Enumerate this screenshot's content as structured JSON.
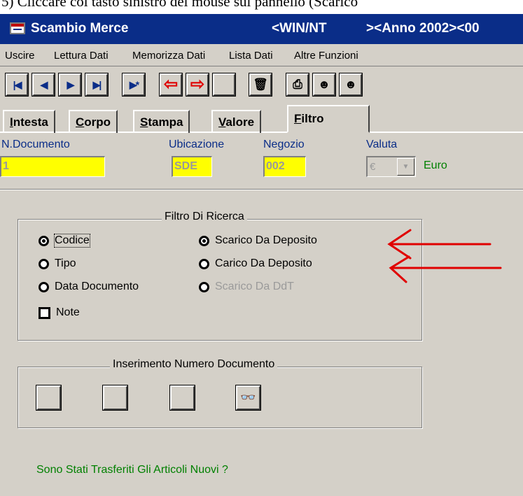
{
  "caption": "5)  Cliccare  col tasto sinistro del mouse sul pannello (Scarico",
  "window": {
    "title": "Scambio Merce",
    "system_a": "<WIN/NT",
    "system_b": "><Anno 2002><00"
  },
  "menu": [
    "Uscire",
    "Lettura Dati",
    "Memorizza Dati",
    "Lista Dati",
    "Altre Funzioni"
  ],
  "toolbar": {
    "icons": [
      "first-record",
      "previous-record",
      "next-record",
      "last-record",
      "new-record",
      "arrow-left",
      "arrow-right",
      "blank",
      "trash",
      "printer",
      "person",
      "person"
    ]
  },
  "tabs": [
    {
      "first": "I",
      "rest": "ntesta"
    },
    {
      "first": "C",
      "rest": "orpo"
    },
    {
      "first": "S",
      "rest": "tampa"
    },
    {
      "first": "V",
      "rest": "alore"
    },
    {
      "first": "F",
      "rest": "iltro"
    }
  ],
  "fields": {
    "documento": {
      "label": "N.Documento",
      "value": "1"
    },
    "ubicazione": {
      "label": "Ubicazione",
      "value": "SDE"
    },
    "negozio": {
      "label": "Negozio",
      "value": "002"
    },
    "valuta": {
      "label": "Valuta",
      "value": "€",
      "name": "Euro"
    }
  },
  "filtro": {
    "legend": "Filtro Di Ricerca",
    "left": [
      {
        "label": "Codice",
        "checked": true
      },
      {
        "label": "Tipo",
        "checked": false
      },
      {
        "label": "Data Documento",
        "checked": false
      }
    ],
    "right": [
      {
        "label": "Scarico Da Deposito",
        "checked": true
      },
      {
        "label": "Carico Da Deposito",
        "checked": false
      },
      {
        "label": "Scarico Da DdT",
        "checked": false,
        "disabled": true
      }
    ],
    "note_label": "Note"
  },
  "inserimento": {
    "legend": "Inserimento Numero Documento",
    "buttons": [
      "blank",
      "blank",
      "blank",
      "binoculars"
    ]
  },
  "status_message": "Sono Stati Trasferiti  Gli Articoli Nuovi ?",
  "colors": {
    "titlebar": "#0a2d88",
    "face": "#d4d0c8",
    "field_yellow": "#ffff00",
    "label_blue": "#0a2d88",
    "green_text": "#008000",
    "annotation_arrow": "#e00000"
  }
}
